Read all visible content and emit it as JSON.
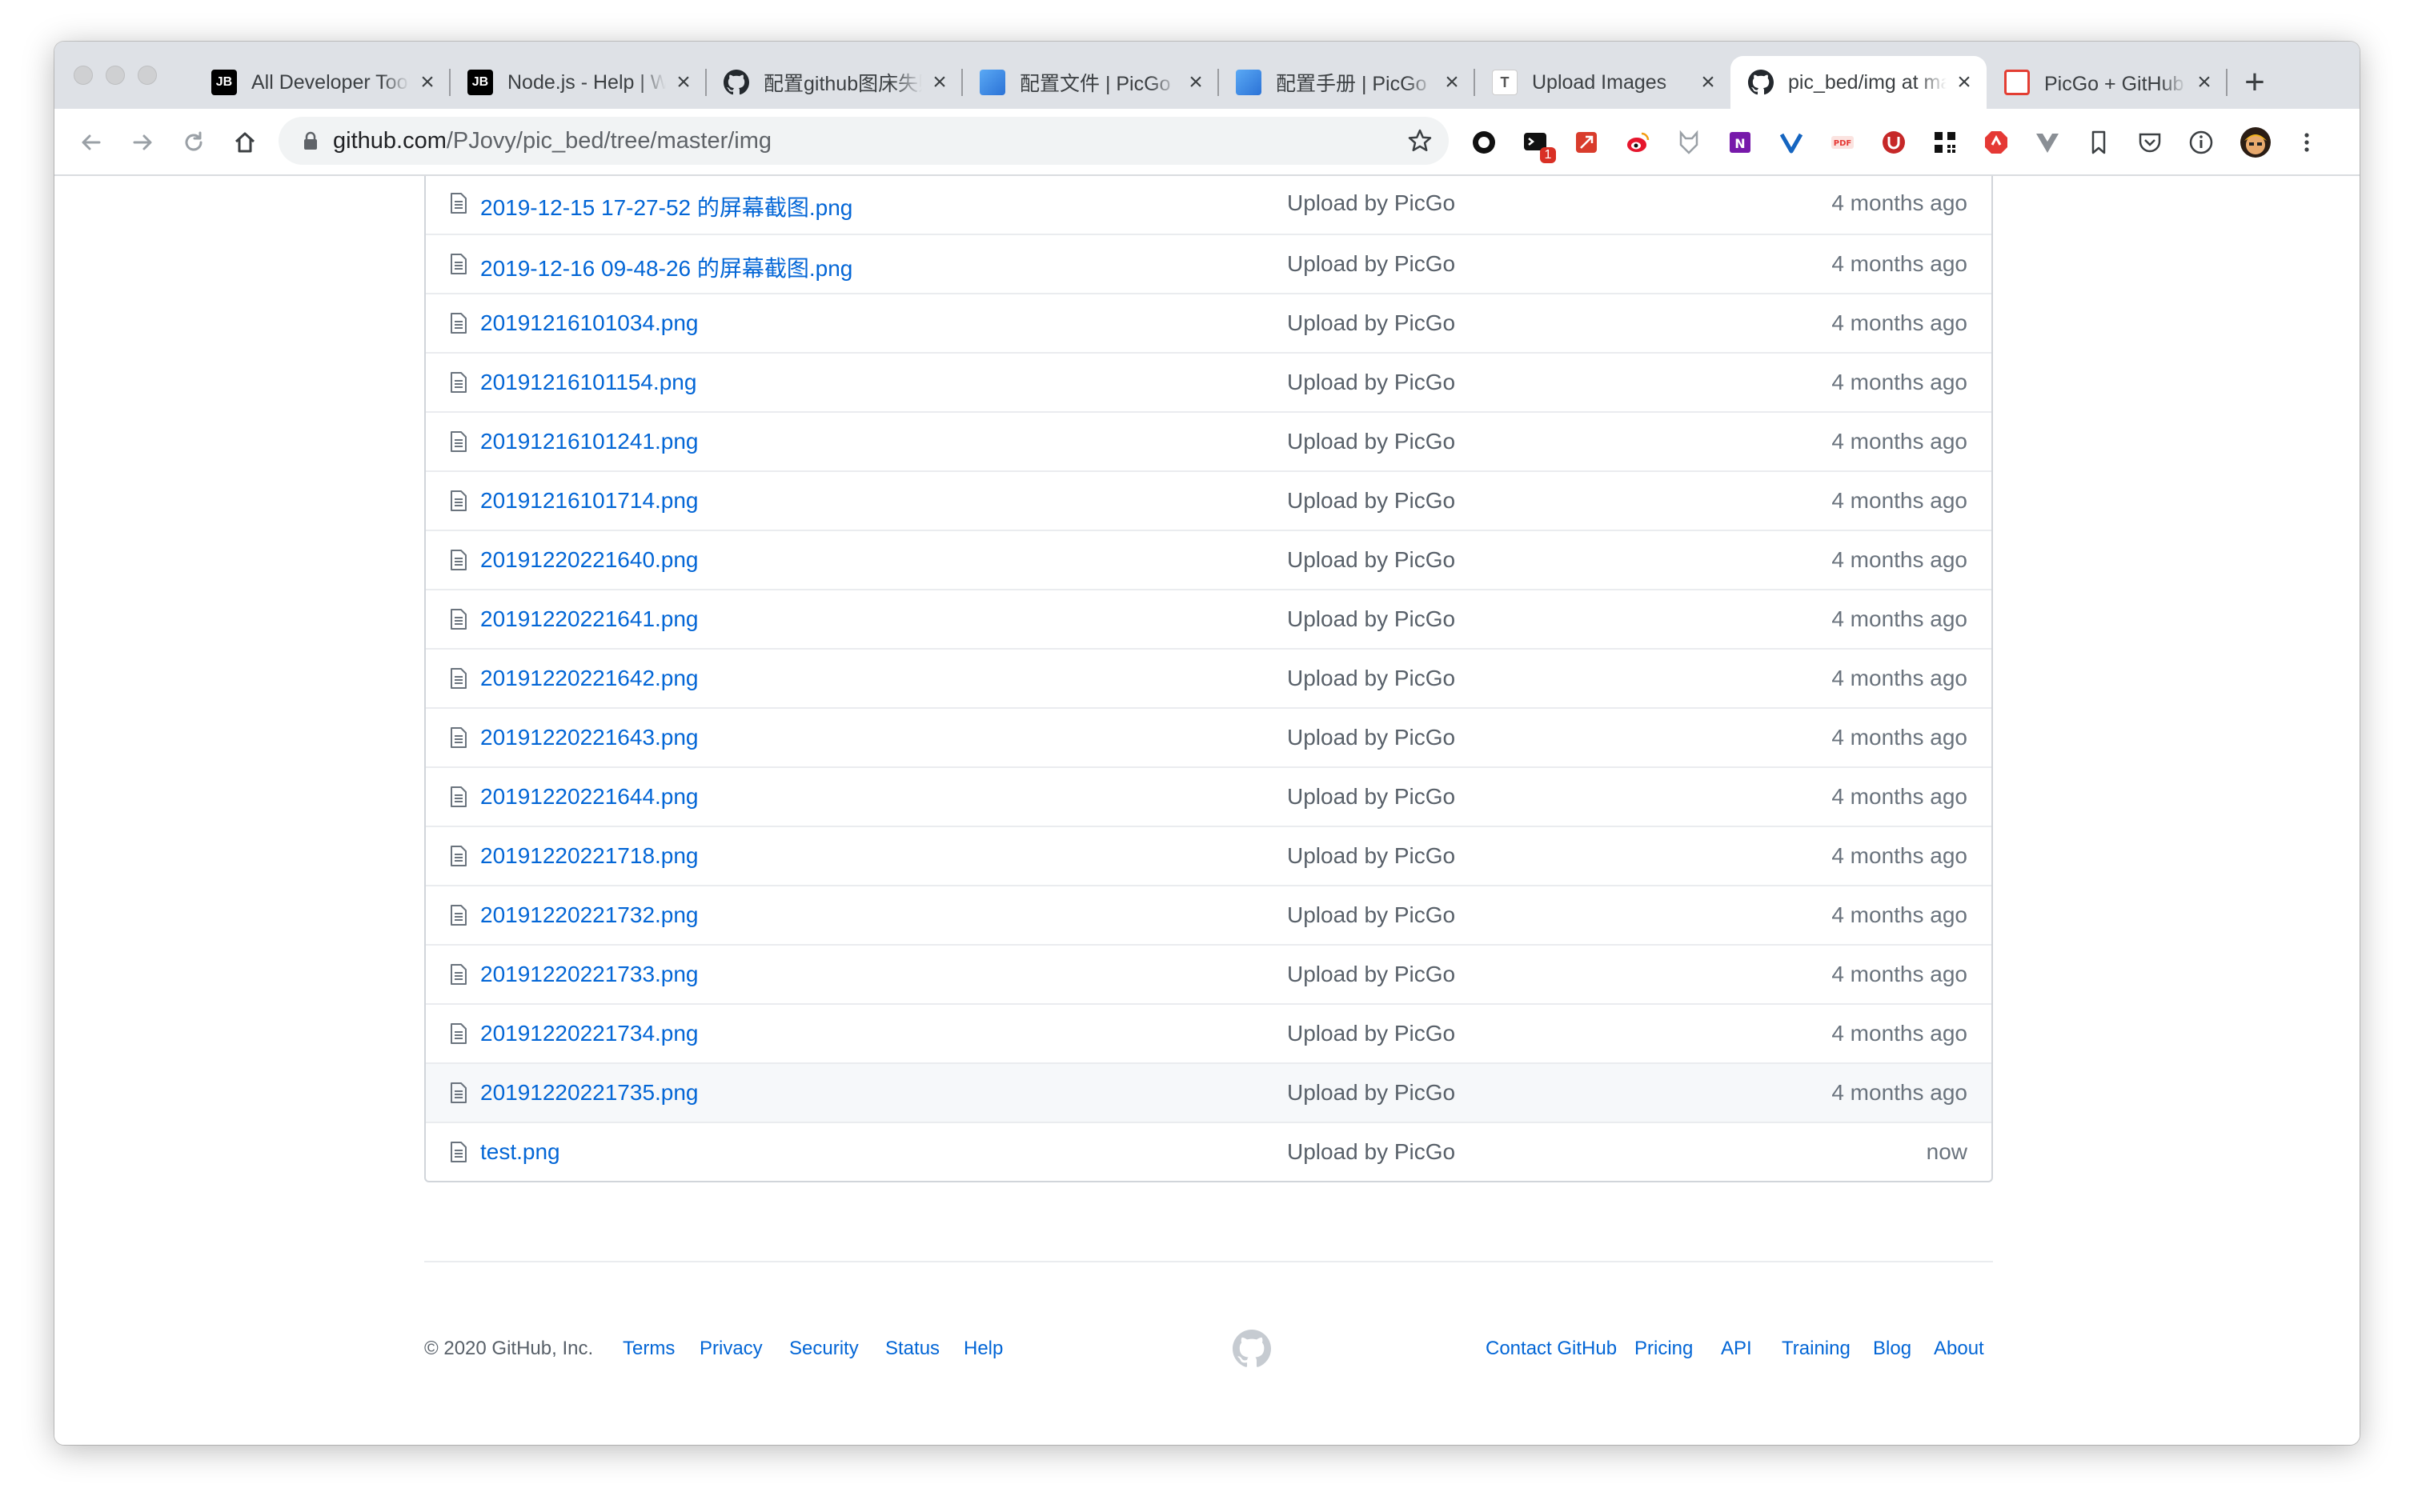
{
  "tabs": [
    {
      "title": "All Developer Tools and Products by JetBrains",
      "icon": "jetbrains-icon"
    },
    {
      "title": "Node.js - Help | WebStorm",
      "icon": "jetbrains-icon"
    },
    {
      "title": "配置github图床失败",
      "icon": "github-icon"
    },
    {
      "title": "配置文件 | PicGo",
      "icon": "picgo-icon"
    },
    {
      "title": "配置手册 | PicGo",
      "icon": "picgo-icon"
    },
    {
      "title": "Upload Images",
      "icon": "typora-icon"
    },
    {
      "title": "pic_bed/img at master",
      "icon": "github-icon"
    },
    {
      "title": "PicGo + GitHub 搭建图床",
      "icon": "csdn-icon"
    }
  ],
  "address_bar": {
    "host": "github.com",
    "path": "/PJovy/pic_bed/tree/master/img"
  },
  "extensions": [
    {
      "icon": "circle-ext-icon"
    },
    {
      "icon": "terminal-ext-icon",
      "badge": "1"
    },
    {
      "icon": "red-ext-icon"
    },
    {
      "icon": "weibo-icon"
    },
    {
      "icon": "fox-ext-icon"
    },
    {
      "icon": "onenote-icon"
    },
    {
      "icon": "v-ext-icon"
    },
    {
      "icon": "pdf-ext-icon"
    },
    {
      "icon": "ublock-icon"
    },
    {
      "icon": "qr-code-icon"
    },
    {
      "icon": "adblock-icon"
    },
    {
      "icon": "vue-devtools-icon"
    },
    {
      "icon": "bookmark-icon"
    },
    {
      "icon": "pocket-icon"
    },
    {
      "icon": "info-icon"
    },
    {
      "icon": "profile-avatar"
    },
    {
      "icon": "menu-icon"
    }
  ],
  "files": [
    {
      "name": "2019-12-15 17-27-52 的屏幕截图.png",
      "message": "Upload by PicGo",
      "age": "4 months ago"
    },
    {
      "name": "2019-12-16 09-48-26 的屏幕截图.png",
      "message": "Upload by PicGo",
      "age": "4 months ago"
    },
    {
      "name": "20191216101034.png",
      "message": "Upload by PicGo",
      "age": "4 months ago"
    },
    {
      "name": "20191216101154.png",
      "message": "Upload by PicGo",
      "age": "4 months ago"
    },
    {
      "name": "20191216101241.png",
      "message": "Upload by PicGo",
      "age": "4 months ago"
    },
    {
      "name": "20191216101714.png",
      "message": "Upload by PicGo",
      "age": "4 months ago"
    },
    {
      "name": "20191220221640.png",
      "message": "Upload by PicGo",
      "age": "4 months ago"
    },
    {
      "name": "20191220221641.png",
      "message": "Upload by PicGo",
      "age": "4 months ago"
    },
    {
      "name": "20191220221642.png",
      "message": "Upload by PicGo",
      "age": "4 months ago"
    },
    {
      "name": "20191220221643.png",
      "message": "Upload by PicGo",
      "age": "4 months ago"
    },
    {
      "name": "20191220221644.png",
      "message": "Upload by PicGo",
      "age": "4 months ago"
    },
    {
      "name": "20191220221718.png",
      "message": "Upload by PicGo",
      "age": "4 months ago"
    },
    {
      "name": "20191220221732.png",
      "message": "Upload by PicGo",
      "age": "4 months ago"
    },
    {
      "name": "20191220221733.png",
      "message": "Upload by PicGo",
      "age": "4 months ago"
    },
    {
      "name": "20191220221734.png",
      "message": "Upload by PicGo",
      "age": "4 months ago"
    },
    {
      "name": "20191220221735.png",
      "message": "Upload by PicGo",
      "age": "4 months ago"
    },
    {
      "name": "test.png",
      "message": "Upload by PicGo",
      "age": "now"
    }
  ],
  "footer": {
    "copyright": "© 2020 GitHub, Inc.",
    "left_links": [
      "Terms",
      "Privacy",
      "Security",
      "Status",
      "Help"
    ],
    "right_links": [
      "Contact GitHub",
      "Pricing",
      "API",
      "Training",
      "Blog",
      "About"
    ]
  }
}
